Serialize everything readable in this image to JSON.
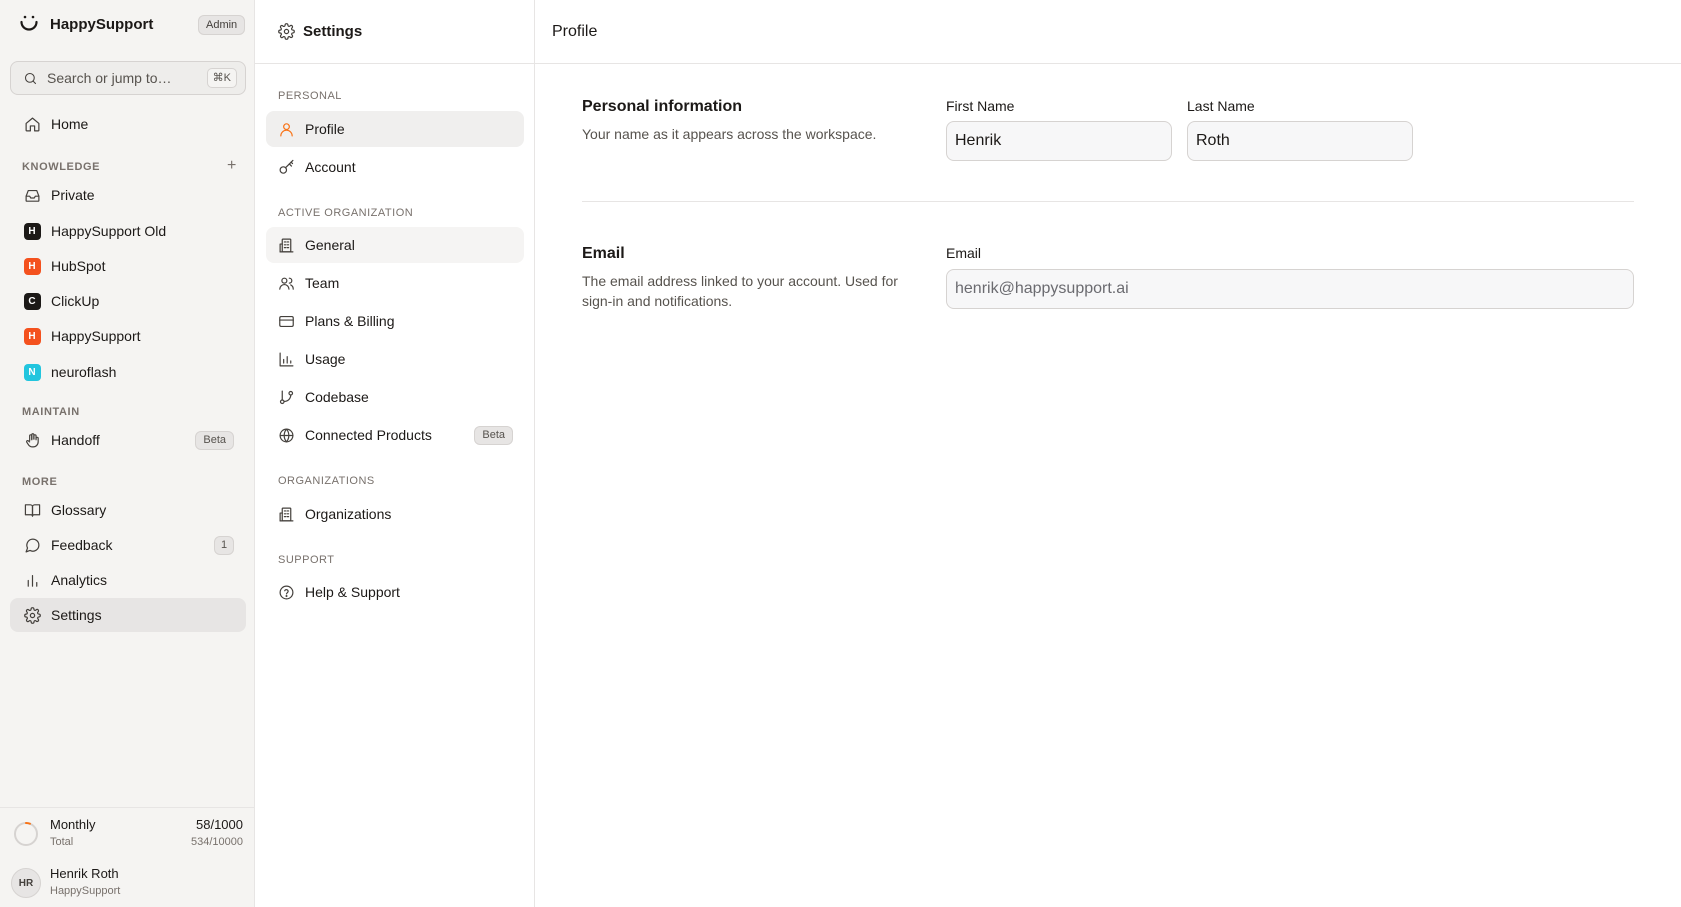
{
  "brand": {
    "name": "HappySupport",
    "role_badge": "Admin"
  },
  "search": {
    "placeholder": "Search or jump to…",
    "shortcut": "⌘K"
  },
  "sidebar": {
    "home": "Home",
    "knowledge_label": "KNOWLEDGE",
    "knowledge_items": [
      {
        "label": "Private"
      },
      {
        "label": "HappySupport Old",
        "initial": "H",
        "color": "#1c1917"
      },
      {
        "label": "HubSpot",
        "initial": "H",
        "color": "#f4511e"
      },
      {
        "label": "ClickUp",
        "initial": "C",
        "color": "#1c1917"
      },
      {
        "label": "HappySupport",
        "initial": "H",
        "color": "#f4511e"
      },
      {
        "label": "neuroflash",
        "initial": "N",
        "color": "#22c5de"
      }
    ],
    "maintain_label": "MAINTAIN",
    "handoff": {
      "label": "Handoff",
      "badge": "Beta"
    },
    "more_label": "MORE",
    "glossary": "Glossary",
    "feedback": {
      "label": "Feedback",
      "count": "1"
    },
    "analytics": "Analytics",
    "settings": "Settings"
  },
  "usage": {
    "name": "Monthly",
    "sub": "Total",
    "value": "58/1000",
    "total": "534/10000",
    "fraction": 0.058,
    "accent": "#f97316"
  },
  "user": {
    "initials": "HR",
    "name": "Henrik Roth",
    "org": "HappySupport"
  },
  "settings_nav": {
    "title": "Settings",
    "personal_label": "PERSONAL",
    "profile": "Profile",
    "account": "Account",
    "active_org_label": "ACTIVE ORGANIZATION",
    "general": "General",
    "team": "Team",
    "plans": "Plans & Billing",
    "usage": "Usage",
    "codebase": "Codebase",
    "connected": {
      "label": "Connected Products",
      "badge": "Beta"
    },
    "orgs_label": "ORGANIZATIONS",
    "organizations": "Organizations",
    "support_label": "SUPPORT",
    "help": "Help & Support"
  },
  "main": {
    "title": "Profile",
    "personal": {
      "title": "Personal information",
      "description": "Your name as it appears across the workspace.",
      "first_name_label": "First Name",
      "first_name": "Henrik",
      "last_name_label": "Last Name",
      "last_name": "Roth"
    },
    "email": {
      "title": "Email",
      "description": "The email address linked to your account. Used for sign-in and notifications.",
      "label": "Email",
      "value": "henrik@happysupport.ai"
    }
  },
  "colors": {
    "accent": "#f97316"
  }
}
